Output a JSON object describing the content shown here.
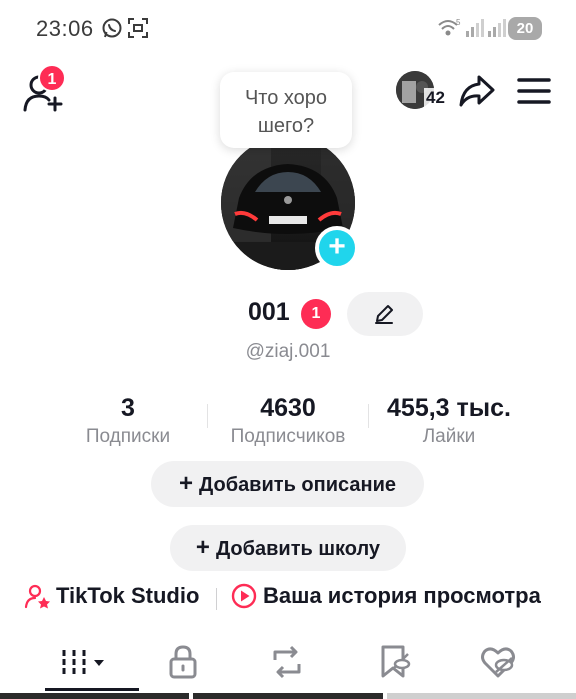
{
  "status_bar": {
    "time": "23:06",
    "battery": "20",
    "icons": [
      "whatsapp-icon",
      "screenshot-icon",
      "wifi-icon",
      "signal-icon",
      "signal-icon-2"
    ]
  },
  "top_bar": {
    "notification_count": "1",
    "views_count": "42",
    "icons": [
      "add-friend-icon",
      "share-icon",
      "menu-icon"
    ]
  },
  "tooltip": {
    "text": "Что хоро шего?"
  },
  "profile": {
    "name": "001",
    "name_badge": "1",
    "username": "@ziaj.001"
  },
  "stats": [
    {
      "value": "3",
      "label": "Подписки"
    },
    {
      "value": "4630",
      "label": "Подписчиков"
    },
    {
      "value": "455,3 тыс.",
      "label": "Лайки"
    }
  ],
  "actions": {
    "add_description": "Добавить описание",
    "add_school": "Добавить школу"
  },
  "links": {
    "studio": "TikTok Studio",
    "history": "Ваша история просмотра"
  },
  "tabs": [
    "videos-grid-icon",
    "lock-icon",
    "repost-icon",
    "bookmark-icon",
    "liked-icon"
  ],
  "colors": {
    "accent_red": "#fe2c55",
    "accent_cyan": "#20d5ec",
    "text_primary": "#161823",
    "text_secondary": "#8a8b91",
    "pill_bg": "#f1f1f2"
  }
}
